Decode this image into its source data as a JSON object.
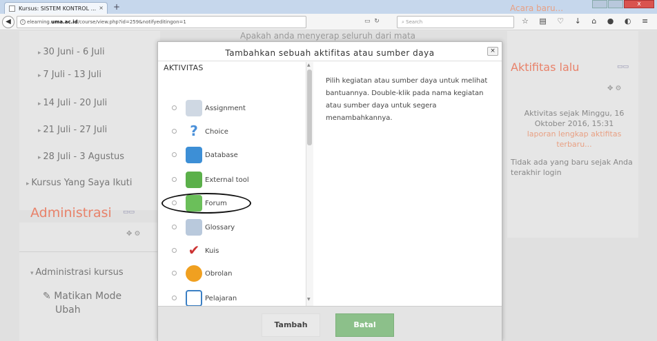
{
  "browser": {
    "tab_title": "Kursus: SISTEM KONTROL ...",
    "tab_close": "×",
    "new_tab": "+",
    "url_prefix": "elearning.",
    "url_domain": "uma.ac.id",
    "url_rest": "/course/view.php?id=259&notifyeditingon=1",
    "search_placeholder": "Search",
    "win_close": "x"
  },
  "page": {
    "weeks": [
      "30 Juni - 6 Juli",
      "7 Juli - 13 Juli",
      "14 Juli - 20 Juli",
      "21 Juli - 27 Juli",
      "28 Juli - 3 Agustus"
    ],
    "kursus_yang_saya_ikuti": "Kursus Yang Saya Ikuti",
    "admin_title": "Administrasi",
    "admin_kursus": "Administrasi kursus",
    "matikan": "Matikan Mode",
    "matikan2": "Ubah",
    "behind_text": "Apakah anda menyerap seluruh dari mata",
    "acara_baru": "Acara baru...",
    "aktifitas_lalu": "Aktifitas lalu",
    "aktivitas_sejak": "Aktivitas sejak Minggu, 16 Oktober 2016, 15:31",
    "laporan_link": "laporan lengkap aktifitas terbaru...",
    "tidak_ada": "Tidak ada yang baru sejak Anda terakhir login"
  },
  "modal": {
    "title": "Tambahkan sebuah aktifitas atau sumber daya",
    "close": "×",
    "heading": "AKTIVITAS",
    "help": "Pilih kegiatan atau sumber daya untuk melihat bantuannya. Double-klik pada nama kegiatan atau sumber daya untuk segera menambahkannya.",
    "options": [
      {
        "label": "Assignment",
        "icon": "assignment-icon",
        "color": "#5b8fc9"
      },
      {
        "label": "Choice",
        "icon": "choice-icon",
        "color": "#4a90d9"
      },
      {
        "label": "Database",
        "icon": "database-icon",
        "color": "#3d8fd6"
      },
      {
        "label": "External tool",
        "icon": "external-tool-icon",
        "color": "#5bb04a"
      },
      {
        "label": "Forum",
        "icon": "forum-icon",
        "color": "#4caf50"
      },
      {
        "label": "Glossary",
        "icon": "glossary-icon",
        "color": "#7aa0c8"
      },
      {
        "label": "Kuis",
        "icon": "quiz-icon",
        "color": "#cc3333"
      },
      {
        "label": "Obrolan",
        "icon": "chat-icon",
        "color": "#f0a020"
      },
      {
        "label": "Pelajaran",
        "icon": "lesson-icon",
        "color": "#3a7fc4"
      }
    ],
    "add_button": "Tambah",
    "cancel_button": "Batal"
  }
}
